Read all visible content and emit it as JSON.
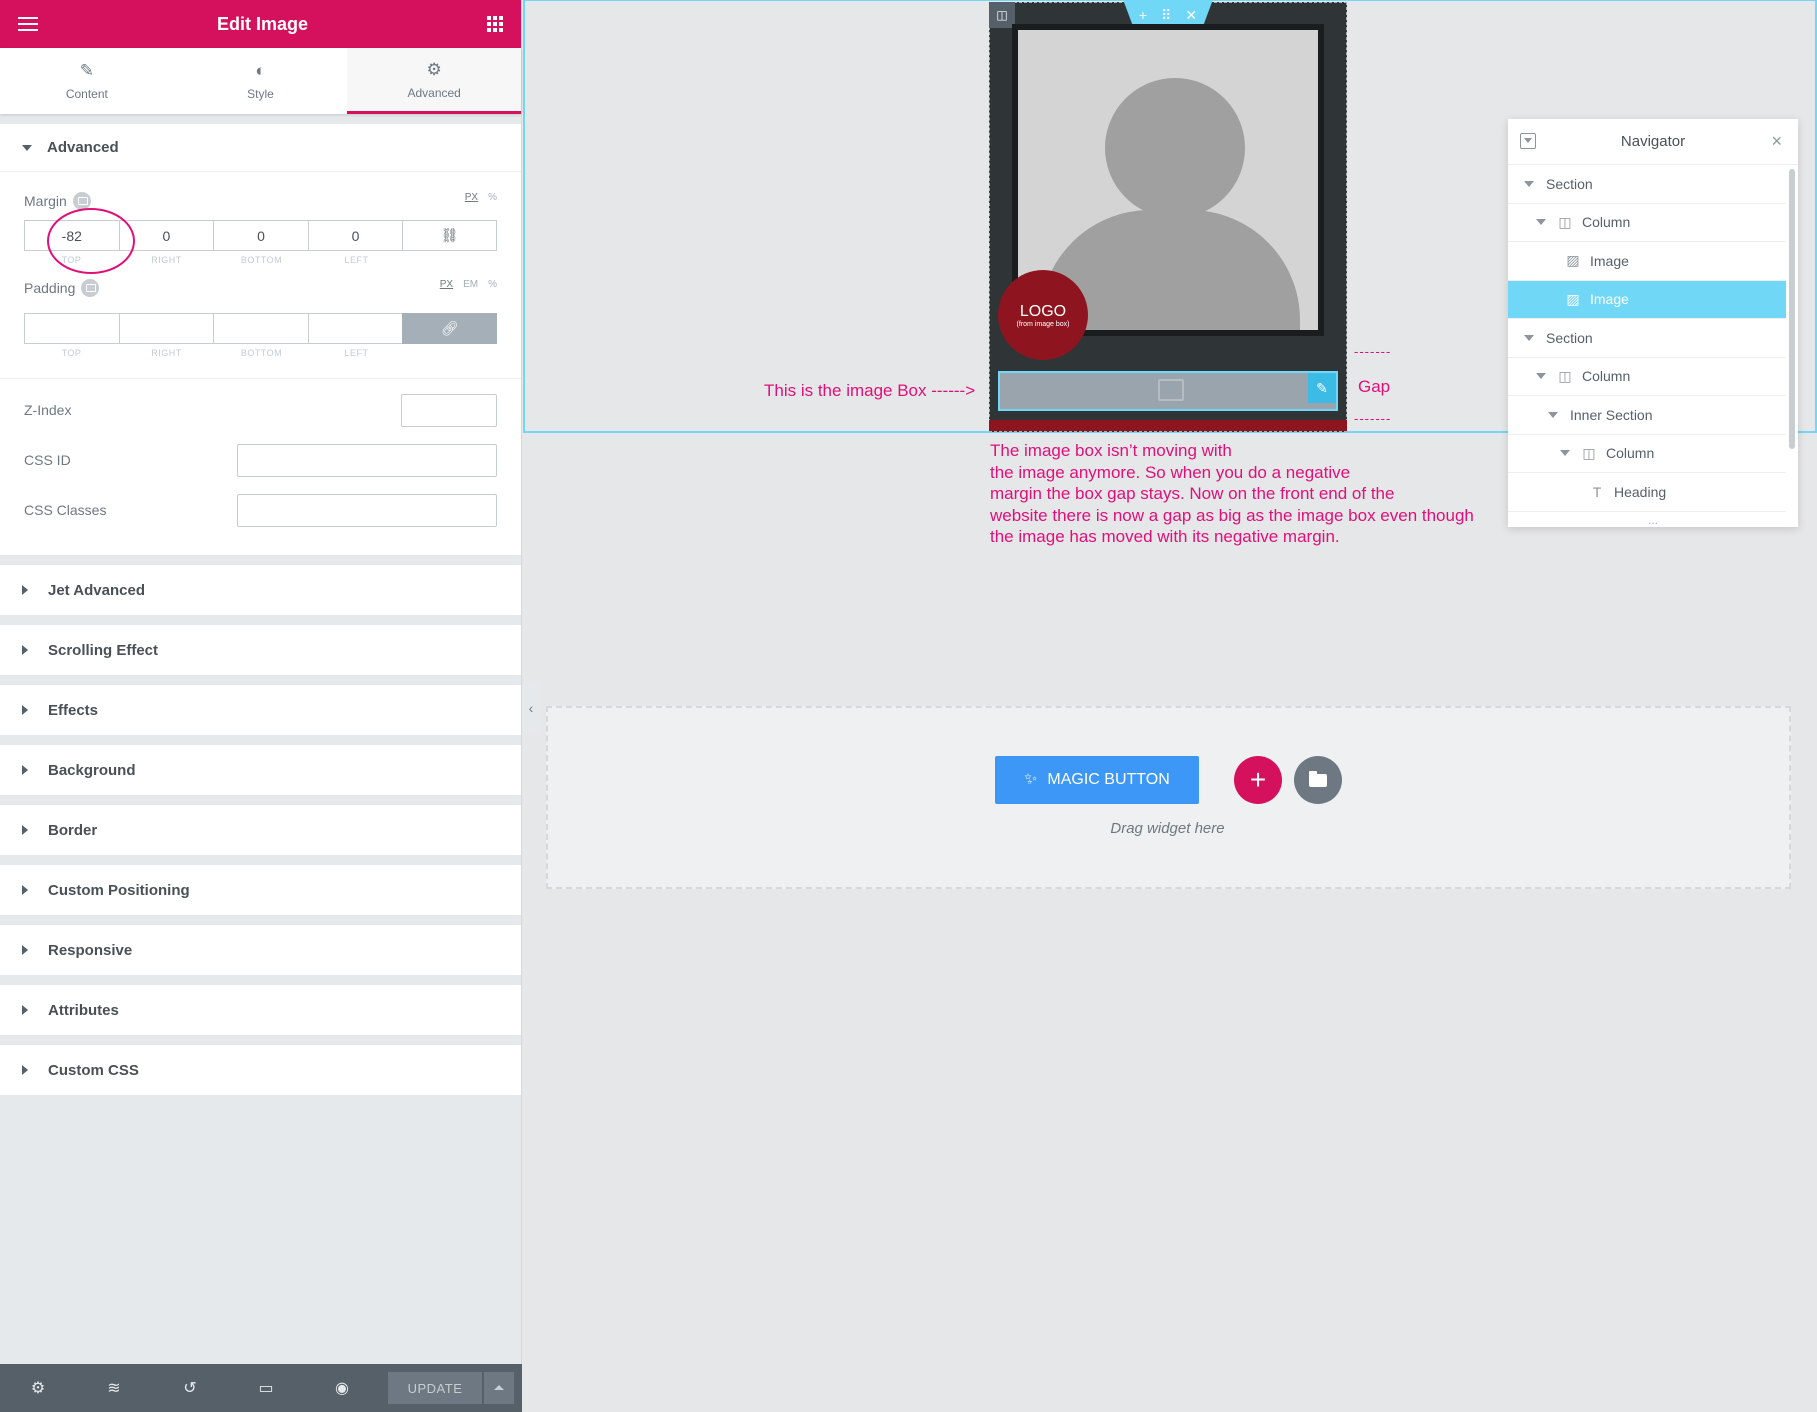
{
  "panel": {
    "title": "Edit Image",
    "tabs": [
      {
        "label": "Content",
        "icon": "pencil-icon"
      },
      {
        "label": "Style",
        "icon": "half-circle-icon"
      },
      {
        "label": "Advanced",
        "icon": "gear-icon"
      }
    ],
    "active_tab": "Advanced",
    "section_title": "Advanced",
    "margin": {
      "label": "Margin",
      "units": [
        "PX",
        "%"
      ],
      "selected_unit": "PX",
      "values": {
        "top": "-82",
        "right": "0",
        "bottom": "0",
        "left": "0"
      },
      "sublabels": [
        "TOP",
        "RIGHT",
        "BOTTOM",
        "LEFT"
      ]
    },
    "padding": {
      "label": "Padding",
      "units": [
        "PX",
        "EM",
        "%"
      ],
      "selected_unit": "PX",
      "values": {
        "top": "",
        "right": "",
        "bottom": "",
        "left": ""
      },
      "sublabels": [
        "TOP",
        "RIGHT",
        "BOTTOM",
        "LEFT"
      ]
    },
    "fields": {
      "z_index": "Z-Index",
      "css_id": "CSS ID",
      "css_classes": "CSS Classes"
    },
    "collapsed_sections": [
      "Jet Advanced",
      "Scrolling Effect",
      "Effects",
      "Background",
      "Border",
      "Custom Positioning",
      "Responsive",
      "Attributes",
      "Custom CSS"
    ],
    "footer": {
      "icons": [
        "gear-icon",
        "layers-icon",
        "history-icon",
        "desktop-icon",
        "eye-icon"
      ],
      "update_label": "UPDATE"
    }
  },
  "canvas": {
    "logo": {
      "text": "LOGO",
      "subtext": "(from image box)"
    },
    "annotations": {
      "image_box_pointer": "This is the image Box ------>",
      "gap_label": "Gap",
      "gap_dashes": "-------",
      "explanation": [
        "The image box isn’t moving with",
        "the image anymore.   So when you do a negative",
        "margin the box gap stays.  Now on the front end of the",
        "website there is now a gap as big as the image box even though",
        "the image has moved with its negative margin."
      ]
    },
    "dropzone": {
      "magic_button": "MAGIC BUTTON",
      "drag_text": "Drag widget here"
    }
  },
  "navigator": {
    "title": "Navigator",
    "items": [
      {
        "label": "Section",
        "depth": 0,
        "icon": "",
        "selected": false
      },
      {
        "label": "Column",
        "depth": 1,
        "icon": "column-icon",
        "selected": false
      },
      {
        "label": "Image",
        "depth": 2,
        "icon": "image-icon",
        "selected": false
      },
      {
        "label": "Image",
        "depth": 2,
        "icon": "image-icon",
        "selected": true
      },
      {
        "label": "Section",
        "depth": 0,
        "icon": "",
        "selected": false
      },
      {
        "label": "Column",
        "depth": 1,
        "icon": "column-icon",
        "selected": false
      },
      {
        "label": "Inner Section",
        "depth": 2,
        "icon": "",
        "selected": false
      },
      {
        "label": "Column",
        "depth": 3,
        "icon": "column-icon",
        "selected": false
      },
      {
        "label": "Heading",
        "depth": 4,
        "icon": "heading-icon",
        "selected": false
      }
    ],
    "more": "..."
  },
  "colors": {
    "brand": "#d5115e",
    "selection": "#71d7f7",
    "annotation": "#e0107a",
    "magic_button": "#3c97f7"
  }
}
